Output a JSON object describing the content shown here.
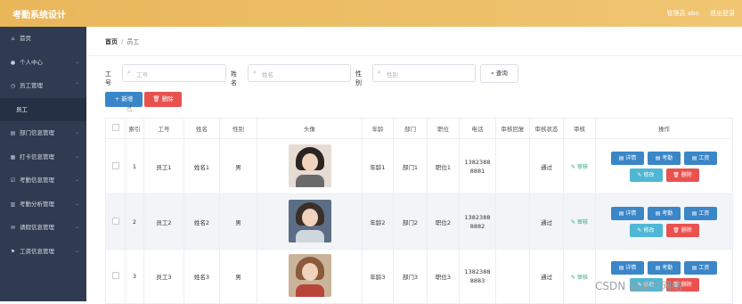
{
  "app": {
    "title": "考勤系统设计",
    "user": "管理员 abo",
    "logout": "退出登录"
  },
  "sidebar": {
    "items": [
      {
        "label": "首页",
        "icon": "home-icon",
        "glyph": "⌂",
        "chevron": false
      },
      {
        "label": "个人中心",
        "icon": "user-icon",
        "glyph": "●",
        "chevron": true
      },
      {
        "label": "员工管理",
        "icon": "clock-icon",
        "glyph": "◷",
        "chevron": true,
        "open": true
      },
      {
        "label": "员工",
        "sub": true
      },
      {
        "label": "部门信息管理",
        "icon": "document-icon",
        "glyph": "▤",
        "chevron": true
      },
      {
        "label": "打卡信息管理",
        "icon": "calendar-icon",
        "glyph": "▦",
        "chevron": true
      },
      {
        "label": "考勤信息管理",
        "icon": "check-icon",
        "glyph": "☑",
        "chevron": true
      },
      {
        "label": "考勤分析管理",
        "icon": "grid-icon",
        "glyph": "▥",
        "chevron": true
      },
      {
        "label": "请假信息管理",
        "icon": "mail-icon",
        "glyph": "✉",
        "chevron": true
      },
      {
        "label": "工资信息管理",
        "icon": "flag-icon",
        "glyph": "⚑",
        "chevron": true
      }
    ]
  },
  "breadcrumb": {
    "home": "首页",
    "current": "员工"
  },
  "filters": {
    "f1": {
      "label": "工号",
      "placeholder": "工号"
    },
    "f2": {
      "label": "姓名",
      "placeholder": "姓名"
    },
    "f3": {
      "label": "性别",
      "placeholder": "性别"
    },
    "query": "查询"
  },
  "actions": {
    "add": "+ 新增",
    "delete": "删除"
  },
  "table": {
    "headers": [
      "",
      "索引",
      "工号",
      "姓名",
      "性别",
      "头像",
      "年龄",
      "部门",
      "职位",
      "电话",
      "审核回复",
      "审核状态",
      "审核",
      "操作"
    ],
    "rows": [
      {
        "index": "1",
        "id": "员工1",
        "name": "姓名1",
        "gender": "男",
        "age": "年龄1",
        "dept": "部门1",
        "position": "职位1",
        "phone1": "1382388",
        "phone2": "8881",
        "reply": "",
        "status": "通过",
        "audit": "✎ 审核"
      },
      {
        "index": "2",
        "id": "员工2",
        "name": "姓名2",
        "gender": "男",
        "age": "年龄2",
        "dept": "部门2",
        "position": "职位2",
        "phone1": "1382388",
        "phone2": "8882",
        "reply": "",
        "status": "通过",
        "audit": "✎ 审核"
      },
      {
        "index": "3",
        "id": "员工3",
        "name": "姓名3",
        "gender": "男",
        "age": "年龄3",
        "dept": "部门3",
        "position": "职位3",
        "phone1": "1382388",
        "phone2": "8883",
        "reply": "",
        "status": "通过",
        "audit": "✎ 审核"
      }
    ],
    "ops": {
      "detail": "▤ 详情",
      "attendance": "▤ 考勤",
      "salary": "▤ 工资",
      "edit": "✎ 修改",
      "remove": "🗑 删除"
    }
  },
  "watermark": "CSDN @真纯网络"
}
